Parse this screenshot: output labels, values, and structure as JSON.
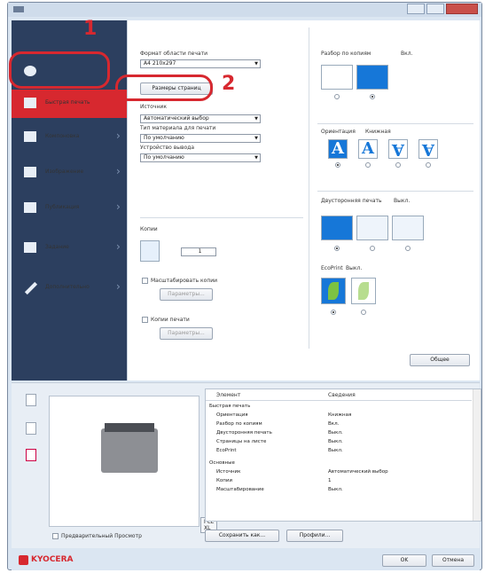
{
  "sidebar": {
    "items": [
      {
        "label": "",
        "icon": "star-icon"
      },
      {
        "label": "Быстрая печать",
        "icon": "print-icon"
      },
      {
        "label": "Компоновка",
        "icon": "layout-icon"
      },
      {
        "label": "Изображение",
        "icon": "image-icon"
      },
      {
        "label": "Публикация",
        "icon": "book-icon"
      },
      {
        "label": "Задание",
        "icon": "job-icon"
      },
      {
        "label": "Дополнительно",
        "icon": "arrow-icon"
      }
    ]
  },
  "main": {
    "print_size_label": "Формат области печати",
    "print_size_value": "A4 210x297",
    "page_size_button": "Размеры страниц",
    "source_label": "Источник",
    "source_value": "Автоматический выбор",
    "media_label": "Тип материала для печати",
    "media_value": "По умолчанию",
    "output_label": "Устройство вывода",
    "output_value": "По умолчанию",
    "copies_label": "Копии",
    "copies_value": "1",
    "scale_label": "Масштабировать копии",
    "scale_button": "Параметры...",
    "watermark_label": "Копии печати",
    "watermark_button": "Параметры...",
    "collate_label": "Разбор по копиям",
    "collate_value": "Вкл.",
    "orientation_label": "Ориентация",
    "orientation_value": "Книжная",
    "duplex_label": "Двусторонняя печать",
    "duplex_value": "Выкл.",
    "ecoprint_label": "EcoPrint",
    "ecoprint_value": "Выкл.",
    "apply_button": "Общее"
  },
  "annotations": {
    "one": "1",
    "two": "2"
  },
  "summary": {
    "col_item": "Элемент",
    "col_value": "Сведения",
    "rows": [
      {
        "k": "Быстрая печать",
        "v": ""
      },
      {
        "k": "Ориентация",
        "v": "Книжная"
      },
      {
        "k": "Разбор по копиям",
        "v": "Вкл."
      },
      {
        "k": "Двусторонняя печать",
        "v": "Выкл."
      },
      {
        "k": "Страницы на листе",
        "v": "Выкл."
      },
      {
        "k": "EcoPrint",
        "v": "Выкл."
      },
      {
        "k": "Основные",
        "v": ""
      },
      {
        "k": "Источник",
        "v": "Автоматический выбор"
      },
      {
        "k": "Копии",
        "v": "1"
      },
      {
        "k": "Масштабирование",
        "v": "Выкл."
      }
    ]
  },
  "bottom": {
    "pcl_label": "PCL XL",
    "preview_checkbox": "Предварительный Просмотр",
    "save_button": "Сохранить как...",
    "profile_button": "Профили..."
  },
  "footer": {
    "logo": "KYOCERA",
    "ok_button": "OK",
    "cancel_button": "Отмена"
  }
}
